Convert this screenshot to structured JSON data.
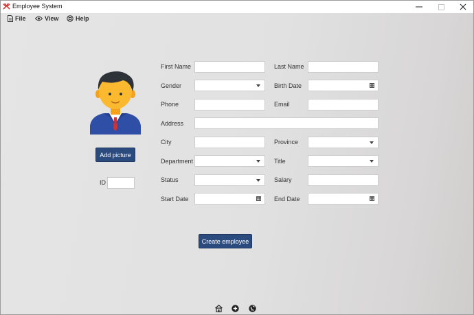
{
  "window": {
    "title": "Employee System"
  },
  "menu": {
    "file": "File",
    "view": "View",
    "help": "Help"
  },
  "buttons": {
    "add_picture": "Add picture",
    "create_employee": "Create employee"
  },
  "id_label": "ID",
  "form": {
    "first_name": "First Name",
    "last_name": "Last Name",
    "gender": "Gender",
    "birth_date": "Birth Date",
    "phone": "Phone",
    "email": "Email",
    "address": "Address",
    "city": "City",
    "province": "Province",
    "department": "Department",
    "title": "Title",
    "status": "Status",
    "salary": "Salary",
    "start_date": "Start Date",
    "end_date": "End Date"
  },
  "icons": {
    "app": "app-logo-icon",
    "file": "document-icon",
    "view": "eye-icon",
    "help": "lifebuoy-icon",
    "bottom": [
      "home-icon",
      "add-circle-icon",
      "globe-icon"
    ]
  },
  "colors": {
    "accent": "#2b4a7e",
    "background": "#e3e3e3"
  }
}
